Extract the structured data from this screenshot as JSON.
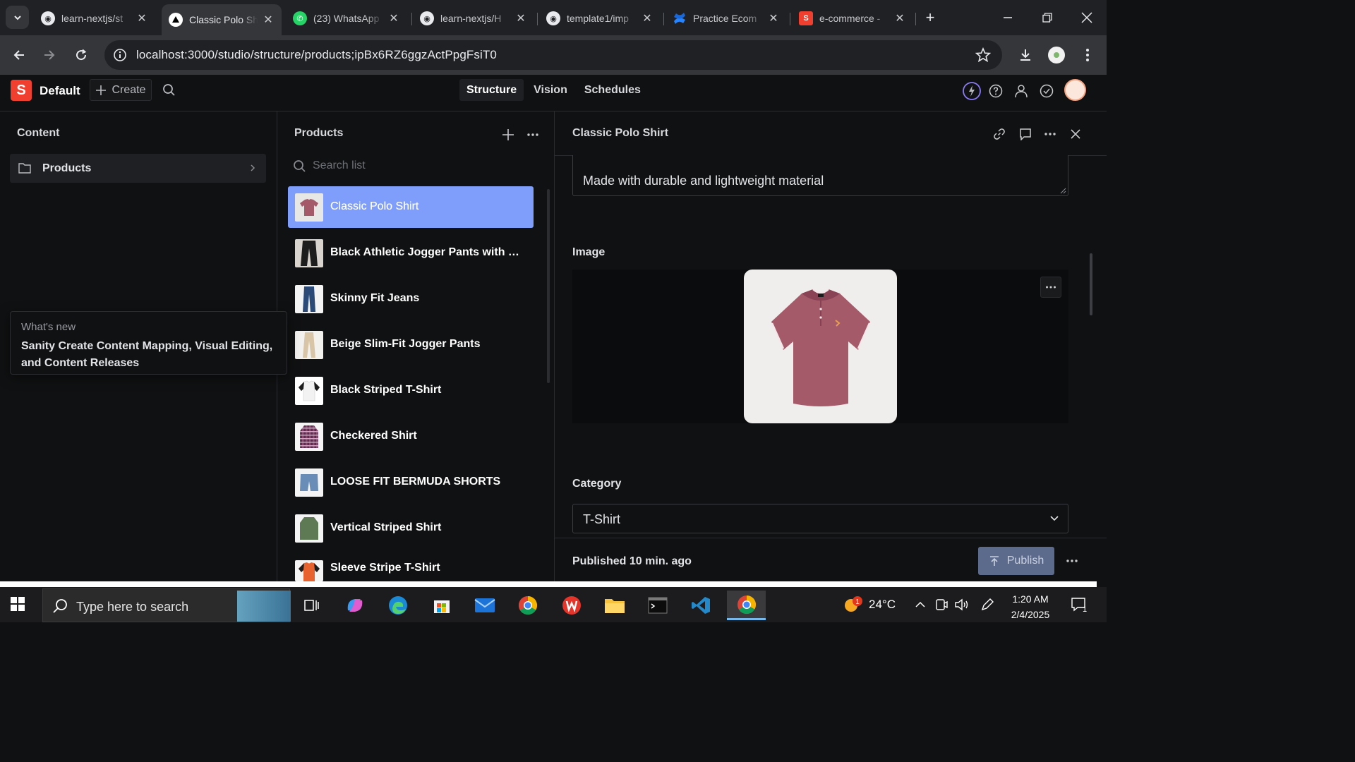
{
  "browser": {
    "tabs": [
      {
        "label": "learn-nextjs/st",
        "icon": "github-icon",
        "active": false
      },
      {
        "label": "Classic Polo Sh",
        "icon": "vercel-icon",
        "active": true
      },
      {
        "label": "(23) WhatsApp",
        "icon": "whatsapp-icon",
        "active": false
      },
      {
        "label": "learn-nextjs/H",
        "icon": "github-icon",
        "active": false
      },
      {
        "label": "template1/imp",
        "icon": "github-icon",
        "active": false
      },
      {
        "label": "Practice Ecom",
        "icon": "confluence-icon",
        "active": false
      },
      {
        "label": "e-commerce -",
        "icon": "sanity-icon",
        "active": false
      }
    ],
    "url": "localhost:3000/studio/structure/products;ipBx6RZ6ggzActPpgFsiT0"
  },
  "studio": {
    "logo_letter": "S",
    "workspace": "Default",
    "create_label": "Create",
    "nav_tabs": [
      "Structure",
      "Vision",
      "Schedules"
    ],
    "selected_tab": "Structure"
  },
  "content_pane": {
    "title": "Content",
    "items": [
      {
        "label": "Products"
      }
    ]
  },
  "whats_new": {
    "label": "What's new",
    "text": "Sanity Create Content Mapping, Visual Editing, and Content Releases"
  },
  "products_pane": {
    "title": "Products",
    "search_placeholder": "Search list",
    "items": [
      {
        "name": "Classic Polo Shirt",
        "thumb": "polo-shirt",
        "color": "#a55a6a",
        "selected": true
      },
      {
        "name": "Black Athletic Jogger Pants with S...",
        "thumb": "jogger-pants",
        "color": "#1d1d1d",
        "selected": false
      },
      {
        "name": "Skinny Fit Jeans",
        "thumb": "jeans",
        "color": "#2b4a78",
        "selected": false
      },
      {
        "name": "Beige Slim-Fit Jogger Pants",
        "thumb": "beige-pants",
        "color": "#d8c5a8",
        "selected": false
      },
      {
        "name": "Black Striped T-Shirt",
        "thumb": "raglan-tshirt",
        "color": "#f2f2f2",
        "selected": false
      },
      {
        "name": "Checkered Shirt",
        "thumb": "checkered-shirt",
        "color": "#5b2a4c",
        "selected": false
      },
      {
        "name": "LOOSE FIT BERMUDA SHORTS",
        "thumb": "shorts",
        "color": "#6a8db8",
        "selected": false
      },
      {
        "name": "Vertical Striped Shirt",
        "thumb": "striped-shirt",
        "color": "#5d7a55",
        "selected": false
      },
      {
        "name": "Sleeve Stripe T-Shirt",
        "thumb": "orange-tshirt",
        "color": "#e8622f",
        "selected": false
      }
    ]
  },
  "document": {
    "title": "Classic Polo Shirt",
    "description_tail": "Made with durable and lightweight material",
    "image_label": "Image",
    "category_label": "Category",
    "category_value": "T-Shirt",
    "status": "Published 10 min. ago",
    "publish_label": "Publish"
  },
  "taskbar": {
    "search_placeholder": "Type here to search",
    "weather": "24°C",
    "weather_badge": "1",
    "time": "1:20 AM",
    "date": "2/4/2025",
    "notification_count": "1"
  },
  "colors": {
    "selection": "#7f9dfb",
    "sanity_red": "#f03e2f",
    "polo": "#a55a6a"
  }
}
